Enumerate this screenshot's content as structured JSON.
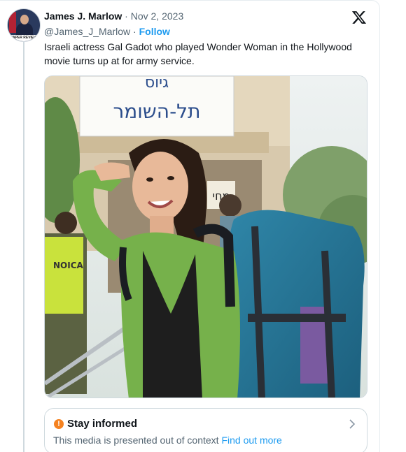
{
  "tweet": {
    "author": {
      "display_name": "James J. Marlow",
      "handle": "@James_J_Marlow",
      "follow_label": "Follow"
    },
    "separator": "·",
    "date": "Nov 2, 2023",
    "text": "Israeli actress Gal Gadot who played Wonder Woman in the Hollywood movie turns up at for army service.",
    "media": {
      "sign_line1": "גיוס",
      "sign_line2": "תל-השומר",
      "post_sign": "מחי",
      "vest_text": "NOICA"
    }
  },
  "context_notice": {
    "icon": "alert-circle-icon",
    "icon_glyph": "!",
    "title": "Stay informed",
    "body": "This media is presented out of context",
    "link": "Find out more",
    "accent_color": "#f58220",
    "link_color": "#1d9bf0"
  },
  "brand": {
    "icon": "x-logo-icon"
  },
  "avatar": {
    "label": "PAPER REVIEW"
  }
}
